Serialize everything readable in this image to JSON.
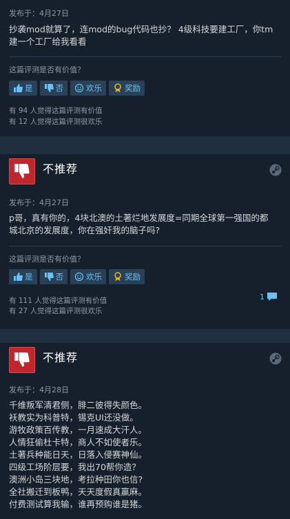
{
  "reviews": [
    {
      "verdict": "",
      "posted": "发布于：4月27日",
      "content": [
        "抄袭mod就算了，连mod的bug代码也抄？ 4级科技要建工厂，你tm",
        "建一个工厂给我看看"
      ],
      "helpful_question": "这篇评测是否有价值？",
      "buttons": {
        "yes": "是",
        "no": "否",
        "funny": "欢乐",
        "award": "奖励"
      },
      "stats": [
        "有 94 人觉得这篇评测有价值",
        "有 12 人觉得这篇评测很欢乐"
      ],
      "comments": ""
    },
    {
      "verdict": "不推荐",
      "posted": "发布于：4月27日",
      "content": [
        "p哥，真有你的，4块北澳的土著烂地发展度=同期全球第一强国的都",
        "城北京的发展度，你在强奸我的脑子吗?"
      ],
      "helpful_question": "这篇评测是否有价值？",
      "buttons": {
        "yes": "是",
        "no": "否",
        "funny": "欢乐",
        "award": "奖励"
      },
      "stats": [
        "有 111 人觉得这篇评测有价值",
        "有 27 人觉得这篇评测很欢乐"
      ],
      "comments": "1"
    },
    {
      "verdict": "不推荐",
      "posted": "发布于：4月28日",
      "content": [
        "千维叛军清君侧，腓二彼得失颜色。",
        "袄教实为科普特，锡克UI还没做。",
        "游牧政策百传教，一月速成大汗人。",
        "人情狂偷杜卡特，商人不如使者乐。",
        "土著兵种能日天，日落入侵赛神仙。",
        "四级工场阶层要，我出70帮你造？",
        "澳洲小岛三块地，考拉种田你也信?",
        "全社搬迁到板鸭，天天度假真赢麻。",
        "付费测试算我输，谁再预购谁是猪。"
      ],
      "comments": ""
    }
  ],
  "icons": {
    "thumb_down": "thumbs-down-icon",
    "steam": "steam-logo-icon",
    "comment": "comment-bubble-icon",
    "like": "thumbs-up-icon",
    "dislike": "thumbs-down-small-icon",
    "funny": "smiley-icon",
    "award": "award-icon"
  },
  "colors": {
    "background": "#1b2838",
    "card": "#16202d",
    "not_recommended": "#c0262c",
    "link": "#67c1f5"
  }
}
